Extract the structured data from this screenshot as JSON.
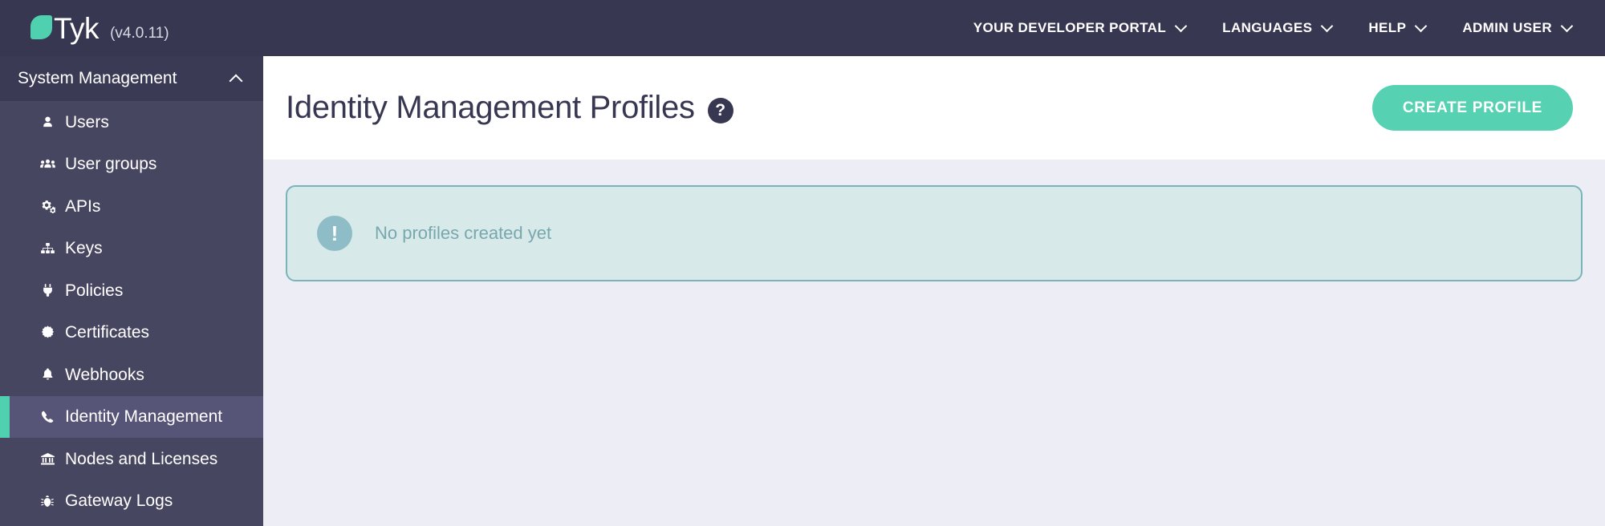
{
  "topbar": {
    "logo_text": "Tyk",
    "logo_icon": "tyk-leaf-logo",
    "version": "(v4.0.11)",
    "nav": [
      {
        "label": "YOUR DEVELOPER PORTAL",
        "icon": "chevron-down-icon"
      },
      {
        "label": "LANGUAGES",
        "icon": "chevron-down-icon"
      },
      {
        "label": "HELP",
        "icon": "chevron-down-icon"
      },
      {
        "label": "ADMIN USER",
        "icon": "chevron-down-icon"
      }
    ]
  },
  "sidebar": {
    "section_title": "System Management",
    "collapse_icon": "chevron-up-icon",
    "accent_color": "#4fd1b0",
    "items": [
      {
        "label": "Users",
        "icon": "user-icon",
        "active": false
      },
      {
        "label": "User groups",
        "icon": "users-group-icon",
        "active": false
      },
      {
        "label": "APIs",
        "icon": "gears-icon",
        "active": false
      },
      {
        "label": "Keys",
        "icon": "sitemap-icon",
        "active": false
      },
      {
        "label": "Policies",
        "icon": "plug-icon",
        "active": false
      },
      {
        "label": "Certificates",
        "icon": "certificate-icon",
        "active": false
      },
      {
        "label": "Webhooks",
        "icon": "bell-icon",
        "active": false
      },
      {
        "label": "Identity Management",
        "icon": "phone-icon",
        "active": true
      },
      {
        "label": "Nodes and Licenses",
        "icon": "bank-icon",
        "active": false
      },
      {
        "label": "Gateway Logs",
        "icon": "bug-icon",
        "active": false
      }
    ]
  },
  "main": {
    "page_title": "Identity Management Profiles",
    "help_icon": "question-mark-icon",
    "help_glyph": "?",
    "create_button_label": "CREATE PROFILE",
    "create_button_color": "#56d1b2",
    "notice": {
      "icon": "exclamation-icon",
      "glyph": "!",
      "message": "No profiles created yet",
      "background": "#d7eae9",
      "border_color": "#7cb3ba",
      "text_color": "#78a7ad"
    }
  }
}
